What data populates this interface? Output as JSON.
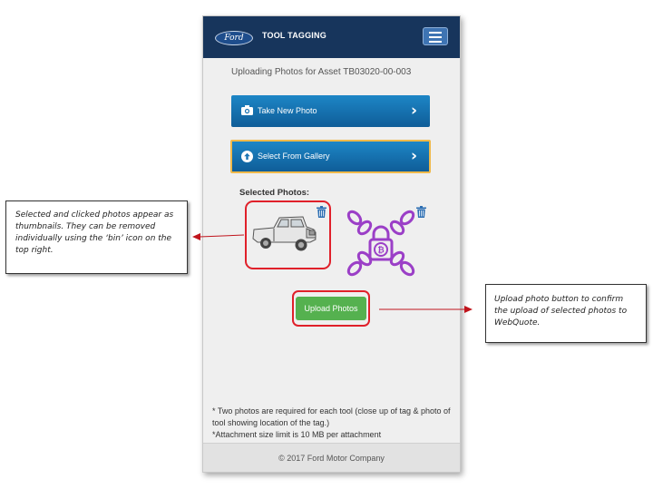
{
  "navbar": {
    "logo_text": "Ford",
    "app_title": "TOOL TAGGING",
    "menu_icon": "hamburger-menu-icon"
  },
  "main": {
    "heading": "Uploading Photos for Asset TB03020-00-003",
    "take_photo": {
      "label": "Take New Photo",
      "icon": "camera-icon"
    },
    "gallery": {
      "label": "Select From Gallery",
      "icon": "upload-circle-icon"
    },
    "selected_label": "Selected Photos:",
    "thumbnails": [
      {
        "icon": "pickup-truck-photo",
        "delete_icon": "trash-bin-icon"
      },
      {
        "icon": "chain-lock-photo",
        "delete_icon": "trash-bin-icon"
      }
    ],
    "upload_label": "Upload Photos"
  },
  "notes": [
    "* Two photos are required for each tool (close up of tag & photo of tool showing location of the tag.)",
    "*Attachment size limit is 10 MB per attachment"
  ],
  "footer": "© 2017 Ford Motor Company",
  "annotations": {
    "thumbnails_note": "Selected and clicked photos appear as thumbnails. They can be removed individually using the ‘bin’ icon on the top right.",
    "upload_note": "Upload photo button to confirm the upload of selected photos to WebQuote."
  },
  "colors": {
    "navbar": "#17355c",
    "button_blue": "#1d86c6",
    "button_green": "#55b14f",
    "highlight_red": "#e0202a",
    "chain_purple": "#9b3fc7"
  }
}
